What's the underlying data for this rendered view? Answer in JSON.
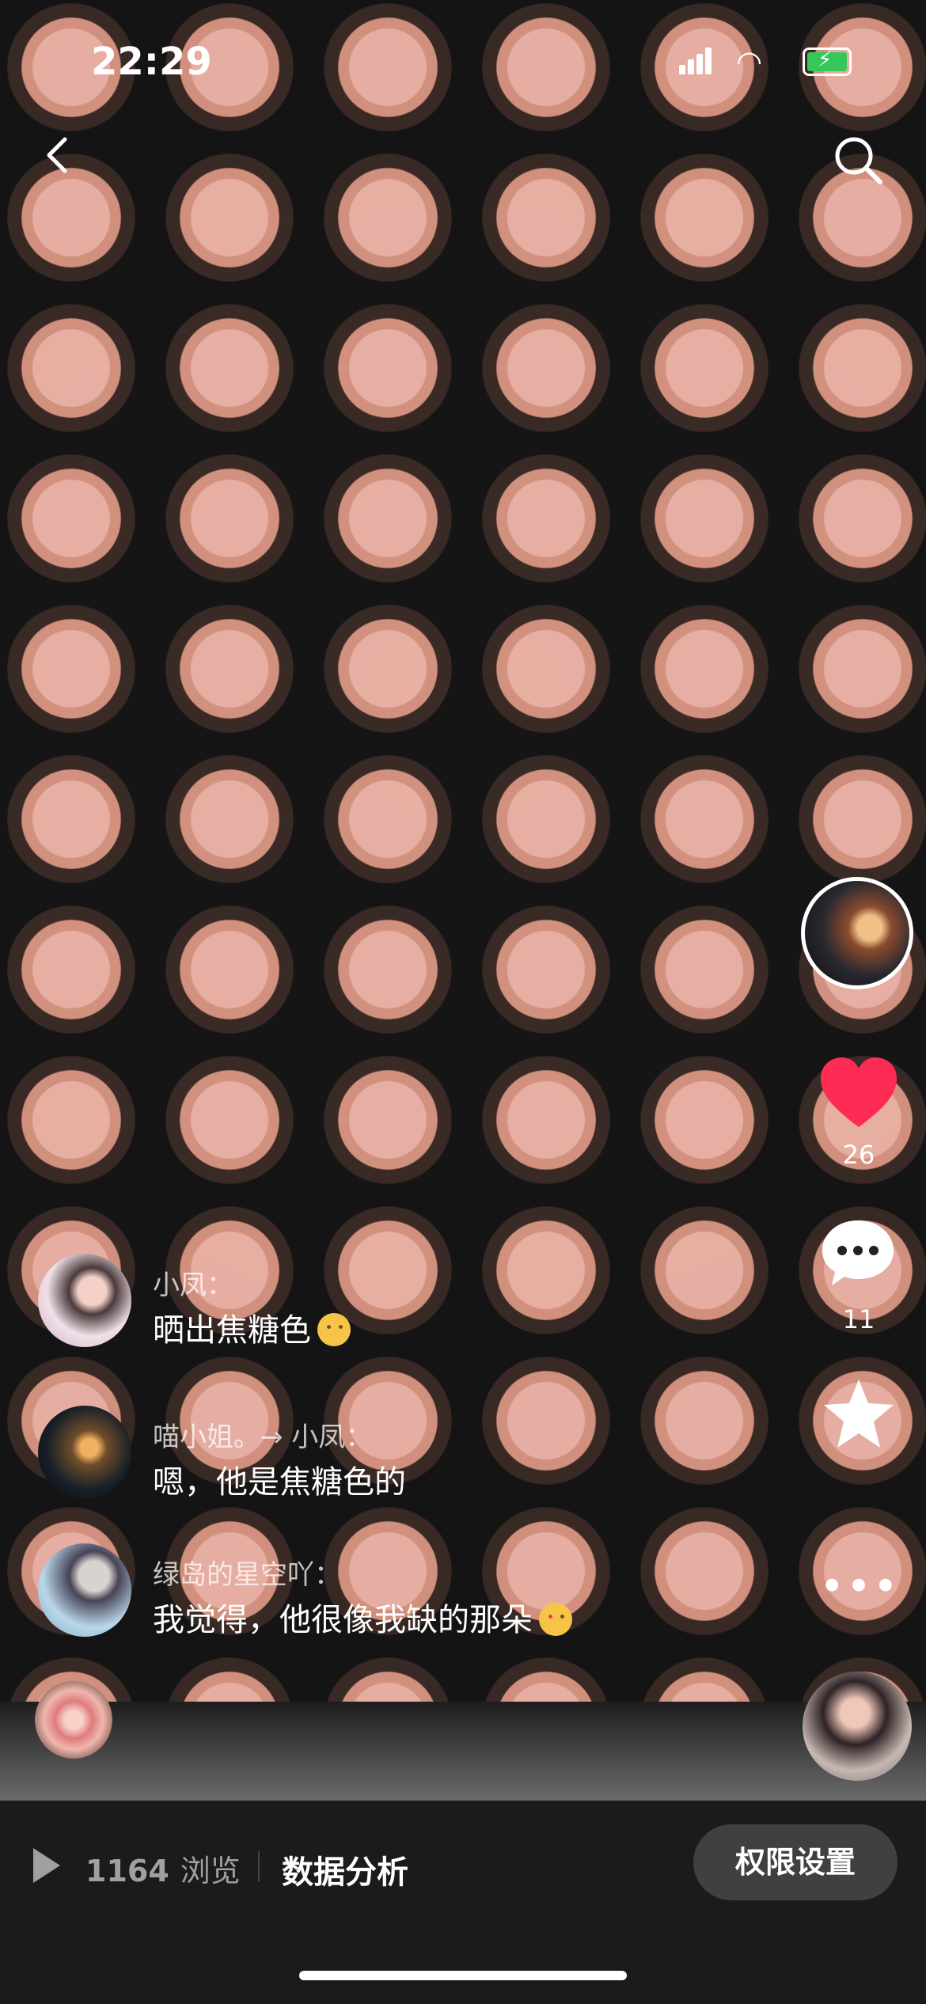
{
  "status_bar": {
    "time": "22:29",
    "battery_color": "#35c759",
    "icons": [
      "signal-icon",
      "wifi-icon",
      "battery-charging-icon"
    ]
  },
  "navigation": {
    "icons": [
      "back-icon",
      "search-icon"
    ]
  },
  "actions": {
    "likes": "26",
    "comments": "11",
    "more": "•••",
    "icons": [
      "heart-icon",
      "comment-icon",
      "star-icon"
    ],
    "heart_color": "#fe2c55"
  },
  "comments": [
    {
      "name": "小凤：",
      "text": "晒出焦糖色",
      "emoji_icon": "thinking-face-emoji"
    },
    {
      "name": "喵小姐。→ 小凤：",
      "text": "嗯，他是焦糖色的"
    },
    {
      "name": "绿岛的星空吖：",
      "text": "我觉得，他很像我缺的那朵",
      "emoji_icon": "star-struck-emoji"
    }
  ],
  "bottom_bar": {
    "views_count": "1164",
    "views_label": "浏览",
    "analysis": "数据分析",
    "permission_button": "权限设置"
  }
}
